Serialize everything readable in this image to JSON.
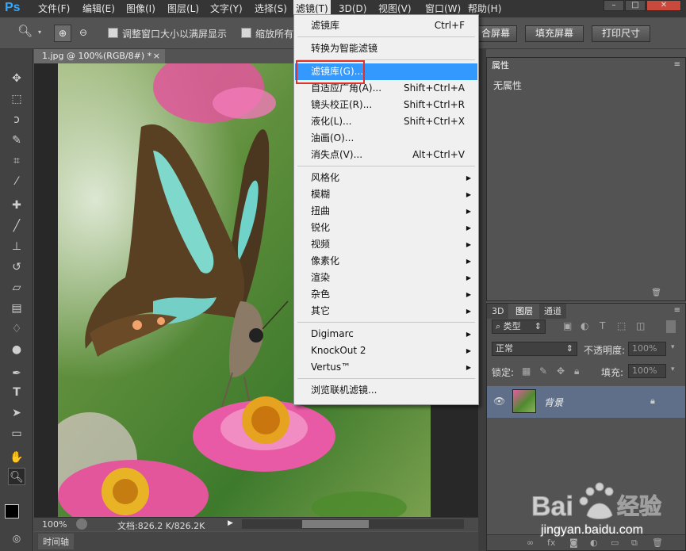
{
  "app": {
    "logo": "Ps"
  },
  "menubar": {
    "items": [
      "文件(F)",
      "编辑(E)",
      "图像(I)",
      "图层(L)",
      "文字(Y)",
      "选择(S)",
      "滤镜(T)",
      "3D(D)",
      "视图(V)",
      "窗口(W)",
      "帮助(H)"
    ],
    "active": "滤镜(T)"
  },
  "options_bar": {
    "checkbox1_label": "调整窗口大小以满屏显示",
    "checkbox2_label": "缩放所有",
    "fit_screen_btn": "合屏幕",
    "fill_screen_btn": "填充屏幕",
    "print_size_btn": "打印尺寸"
  },
  "document": {
    "tab_title": "1.jpg @ 100%(RGB/8#) *",
    "zoom": "100%",
    "doc_size": "文档:826.2 K/826.2K"
  },
  "timeline": {
    "label": "时间轴"
  },
  "properties_panel": {
    "tab": "属性",
    "content": "无属性"
  },
  "layers_panel": {
    "tabs": [
      "3D",
      "图层",
      "通道"
    ],
    "filter_label": "类型",
    "blend_mode": "正常",
    "opacity_label": "不透明度:",
    "opacity_value": "100%",
    "lock_label": "锁定:",
    "fill_label": "填充:",
    "fill_value": "100%",
    "layer_name": "背景"
  },
  "filter_menu": {
    "items": [
      {
        "label": "滤镜库",
        "shortcut": "Ctrl+F"
      },
      {
        "sep": true
      },
      {
        "label": "转换为智能滤镜"
      },
      {
        "sep": true
      },
      {
        "label": "滤镜库(G)...",
        "highlight": true
      },
      {
        "label": "自适应广角(A)...",
        "shortcut": "Shift+Ctrl+A"
      },
      {
        "label": "镜头校正(R)...",
        "shortcut": "Shift+Ctrl+R"
      },
      {
        "label": "液化(L)...",
        "shortcut": "Shift+Ctrl+X"
      },
      {
        "label": "油画(O)..."
      },
      {
        "label": "消失点(V)...",
        "shortcut": "Alt+Ctrl+V"
      },
      {
        "sep": true
      },
      {
        "label": "风格化",
        "submenu": true
      },
      {
        "label": "模糊",
        "submenu": true
      },
      {
        "label": "扭曲",
        "submenu": true
      },
      {
        "label": "锐化",
        "submenu": true
      },
      {
        "label": "视频",
        "submenu": true
      },
      {
        "label": "像素化",
        "submenu": true
      },
      {
        "label": "渲染",
        "submenu": true
      },
      {
        "label": "杂色",
        "submenu": true
      },
      {
        "label": "其它",
        "submenu": true
      },
      {
        "sep": true
      },
      {
        "label": "Digimarc",
        "submenu": true
      },
      {
        "label": "KnockOut 2",
        "submenu": true
      },
      {
        "label": "Vertus™",
        "submenu": true
      },
      {
        "sep": true
      },
      {
        "label": "浏览联机滤镜..."
      }
    ]
  },
  "watermark": {
    "brand": "Bai度经验",
    "url": "jingyan.baidu.com"
  },
  "colors": {
    "menu_highlight": "#3399ff",
    "annotation_box": "#e0322b"
  }
}
